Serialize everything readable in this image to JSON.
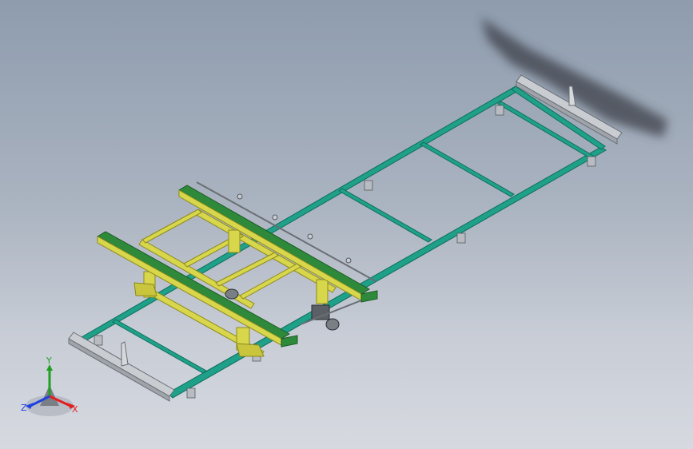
{
  "viewport": {
    "background_top": "#8e9cae",
    "background_bottom": "#d6d9e0"
  },
  "colors": {
    "frame": "#1fa088",
    "frame_dark": "#0f6d5c",
    "carriage": "#d8d64a",
    "carriage_dark": "#8c8a1e",
    "belt": "#2e8a3a",
    "belt_dark": "#1b5a24",
    "end_beam": "#c9cdd2",
    "shadow": "#3c4048"
  },
  "triad": {
    "x_label": "X",
    "y_label": "Y",
    "z_label": "Z",
    "x_color": "#e02020",
    "y_color": "#20a020",
    "z_color": "#2040e0",
    "icons": [
      "triad-icon"
    ]
  }
}
